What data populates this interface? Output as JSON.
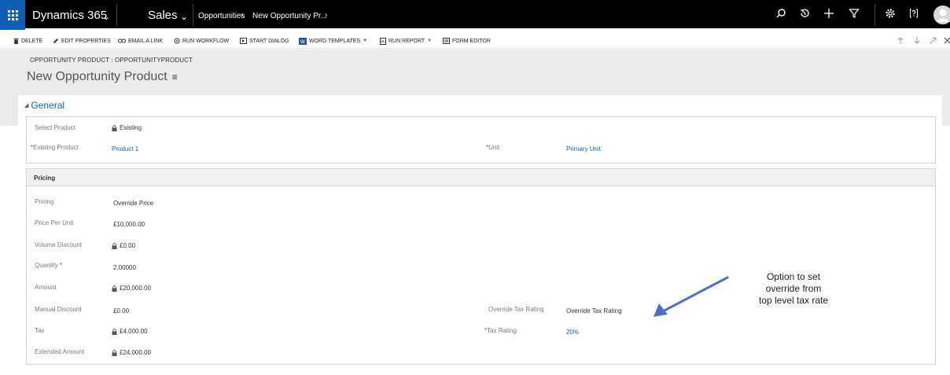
{
  "topbar": {
    "app_name": "Dynamics 365",
    "area": "Sales",
    "breadcrumb": [
      "Opportunities",
      "New Opportunity Pr...",
      ""
    ],
    "icons": [
      "app-launcher-icon",
      "search-icon",
      "recent-icon",
      "plus-icon",
      "filter-icon",
      "settings-icon",
      "help-icon",
      "user-avatar-icon"
    ]
  },
  "commands": [
    {
      "label": "DELETE",
      "icon": "trash-icon"
    },
    {
      "label": "EDIT PROPERTIES",
      "icon": "pencil-icon"
    },
    {
      "label": "EMAIL A LINK",
      "icon": "link-icon"
    },
    {
      "label": "RUN WORKFLOW",
      "icon": "workflow-icon"
    },
    {
      "label": "START DIALOG",
      "icon": "dialog-icon"
    },
    {
      "label": "WORD TEMPLATES",
      "icon": "word-icon",
      "dropdown": true
    },
    {
      "label": "RUN REPORT",
      "icon": "report-icon",
      "dropdown": true
    },
    {
      "label": "FORM EDITOR",
      "icon": "form-editor-icon"
    }
  ],
  "header": {
    "entity_label": "OPPORTUNITY PRODUCT : OPPORTUNITYPRODUCT",
    "record_title": "New Opportunity Product",
    "menu_glyph": "≡"
  },
  "general": {
    "section_title": "General",
    "select_product_label": "Select Product",
    "select_product_value": "Existing",
    "existing_product_label": "Existing Product",
    "existing_product_value": "Product 1",
    "unit_label": "Unit",
    "unit_value": "Primary Unit"
  },
  "pricing": {
    "title": "Pricing",
    "fields": {
      "pricing": {
        "label": "Pricing",
        "value": "Override Price"
      },
      "price_per_unit": {
        "label": "Price Per Unit",
        "value": "£10,000.00"
      },
      "volume_discount": {
        "label": "Volume Discount",
        "value": "£0.00"
      },
      "quantity": {
        "label": "Quantity",
        "value": "2.00000"
      },
      "amount": {
        "label": "Amount",
        "value": "£20,000.00"
      },
      "manual_discount": {
        "label": "Manual Discount",
        "value": "£0.00"
      },
      "tax": {
        "label": "Tax",
        "value": "£4,000.00"
      },
      "extended_amount": {
        "label": "Extended Amount",
        "value": "£24,000.00"
      },
      "override_tax_rating": {
        "label": "Override Tax Rating",
        "value": "Override Tax Rating"
      },
      "tax_rating": {
        "label": "Tax Rating",
        "value": "20%"
      }
    }
  },
  "annotation": {
    "line1": "Option to set",
    "line2": "override from",
    "line3": "top level tax rate"
  },
  "colors": {
    "accent": "#1160b7",
    "required": "#c0392b",
    "annotation_arrow": "#4a72c4"
  }
}
